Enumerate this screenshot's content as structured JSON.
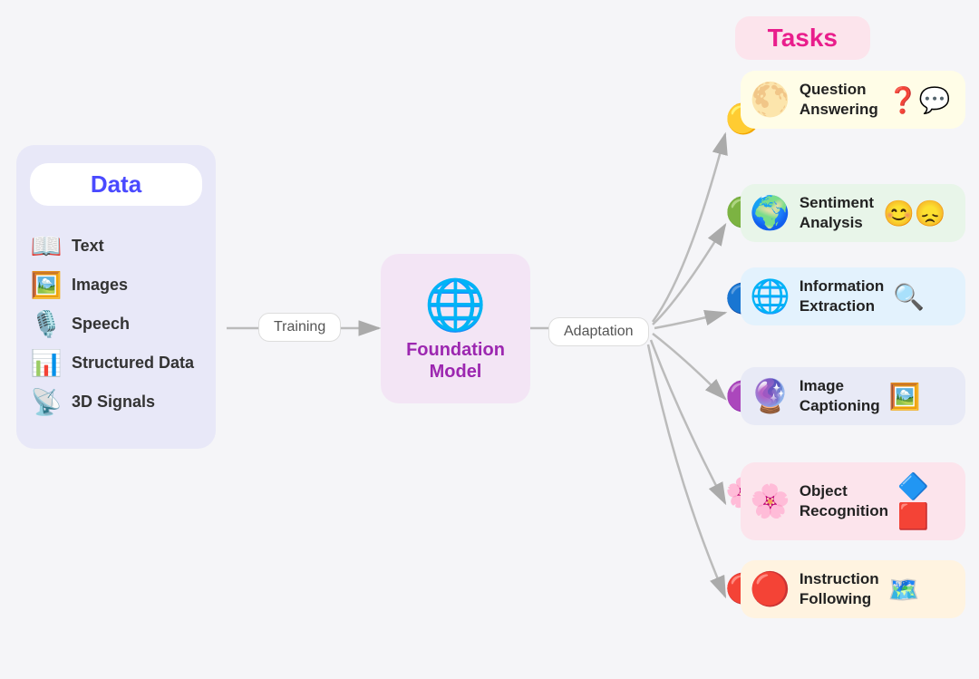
{
  "data_section": {
    "title": "Data",
    "items": [
      {
        "label": "Text",
        "icon": "📖"
      },
      {
        "label": "Images",
        "icon": "🖼️"
      },
      {
        "label": "Speech",
        "icon": "🎤"
      },
      {
        "label": "Structured Data",
        "icon": "📊"
      },
      {
        "label": "3D Signals",
        "icon": "📡"
      }
    ]
  },
  "tasks_section": {
    "title": "Tasks",
    "items": [
      {
        "id": "qa",
        "label": "Question Answering",
        "globe": "🌐",
        "globe_color": "gold",
        "icon": "❓",
        "bg": "#fffde7"
      },
      {
        "id": "sa",
        "label": "Sentiment Analysis",
        "globe": "🌐",
        "globe_color": "green",
        "icon": "😊",
        "bg": "#e8f5e9"
      },
      {
        "id": "ie",
        "label": "Information Extraction",
        "globe": "🌐",
        "globe_color": "blue",
        "icon": "🔍",
        "bg": "#e3f2fd"
      },
      {
        "id": "ic",
        "label": "Image Captioning",
        "globe": "🌐",
        "globe_color": "purple",
        "icon": "🖼️",
        "bg": "#e8eaf6"
      },
      {
        "id": "or",
        "label": "Object Recognition",
        "globe": "🌐",
        "globe_color": "pink",
        "icon": "🔷",
        "bg": "#fce4ec"
      },
      {
        "id": "if",
        "label": "Instruction Following",
        "globe": "🌐",
        "globe_color": "red",
        "icon": "🗺️",
        "bg": "#fff3e0"
      }
    ]
  },
  "foundation_model": {
    "label": "Foundation\nModel",
    "globe": "🌐"
  },
  "labels": {
    "training": "Training",
    "adaptation": "Adaptation"
  }
}
